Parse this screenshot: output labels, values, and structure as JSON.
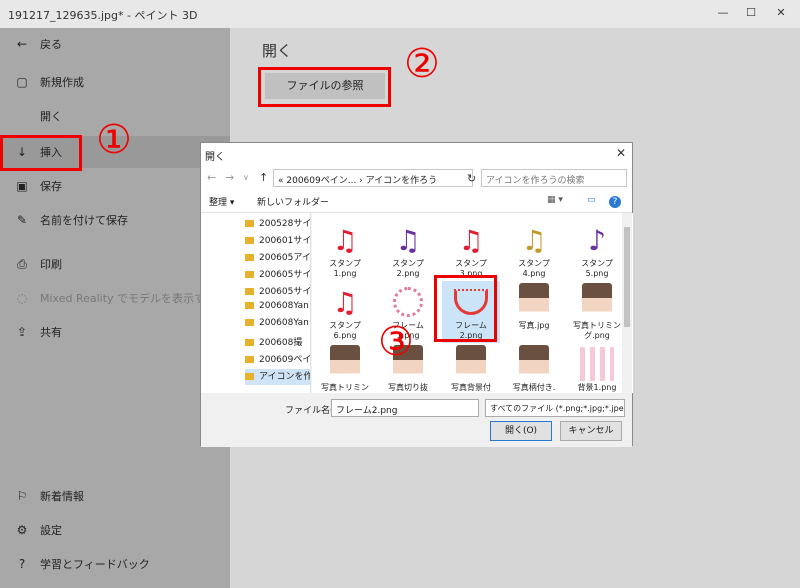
{
  "window": {
    "title": "191217_129635.jpg* - ペイント 3D",
    "controls": [
      "—",
      "☐",
      "✕"
    ]
  },
  "sidebar": {
    "items": [
      {
        "icon": "back-arrow-icon",
        "glyph": "←",
        "label": "戻る"
      },
      {
        "icon": "new-file-icon",
        "glyph": "▢",
        "label": "新規作成"
      },
      {
        "icon": "open-icon",
        "glyph": "",
        "label": "開く"
      },
      {
        "icon": "insert-icon",
        "glyph": "↓",
        "label": "挿入"
      },
      {
        "icon": "save-icon",
        "glyph": "▣",
        "label": "保存"
      },
      {
        "icon": "save-as-icon",
        "glyph": "✎",
        "label": "名前を付けて保存"
      },
      {
        "icon": "print-icon",
        "glyph": "⎙",
        "label": "印刷"
      },
      {
        "icon": "mixed-reality-icon",
        "glyph": "◌",
        "label": "Mixed Reality でモデルを表示する"
      },
      {
        "icon": "share-icon",
        "glyph": "⇪",
        "label": "共有"
      },
      {
        "icon": "news-icon",
        "glyph": "⚐",
        "label": "新着情報"
      },
      {
        "icon": "settings-icon",
        "glyph": "⚙",
        "label": "設定"
      },
      {
        "icon": "help-icon",
        "glyph": "?",
        "label": "学習とフィードバック"
      }
    ]
  },
  "main": {
    "title": "開く",
    "browse_label": "ファイルの参照"
  },
  "annotations": [
    "①",
    "②",
    "③"
  ],
  "dialog": {
    "title": "開く",
    "close": "✕",
    "nav": [
      "←",
      "→",
      "∨",
      "↑"
    ],
    "path": "« 200609ペイン... › アイコンを作ろう",
    "refresh": "↻",
    "search_placeholder": "アイコンを作ろうの検索",
    "toolbar": {
      "organize": "整理 ▾",
      "new_folder": "新しいフォルダー"
    },
    "folders": [
      "200528サイ",
      "200601サイ",
      "200605アイ",
      "200605サイ",
      "200605サイ",
      "200608Yan",
      "200608Yan",
      "200608撮",
      "200609ペイ",
      "アイコンを作"
    ],
    "files": [
      {
        "name": "スタンプ\n1.png",
        "kind": "note",
        "color": "#e01e2f",
        "glyph": "♫"
      },
      {
        "name": "スタンプ\n2.png",
        "kind": "note",
        "color": "#6b2fa0",
        "glyph": "♫"
      },
      {
        "name": "スタンプ\n3.png",
        "kind": "note",
        "color": "#e01e2f",
        "glyph": "♫"
      },
      {
        "name": "スタンプ\n4.png",
        "kind": "note",
        "color": "#c39a2a",
        "glyph": "♫"
      },
      {
        "name": "スタンプ\n5.png",
        "kind": "note",
        "color": "#6b2fa0",
        "glyph": "♪"
      },
      {
        "name": "スタンプ\n6.png",
        "kind": "note",
        "color": "#e01e2f",
        "glyph": "♫"
      },
      {
        "name": "フレーム\n1.png",
        "kind": "ring"
      },
      {
        "name": "フレーム\n2.png",
        "kind": "bowl"
      },
      {
        "name": "写真.jpg",
        "kind": "face"
      },
      {
        "name": "写真トリミン\nグ.png",
        "kind": "face"
      },
      {
        "name": "写真トリミン",
        "kind": "face"
      },
      {
        "name": "写真切り抜",
        "kind": "face"
      },
      {
        "name": "写真背景付",
        "kind": "face"
      },
      {
        "name": "写真柄付き.",
        "kind": "face"
      },
      {
        "name": "背景1.png",
        "kind": "pink"
      }
    ],
    "filename_label": "ファイル名(N):",
    "filename_value": "フレーム2.png",
    "filetype": "すべてのファイル (*.png;*.jpg;*.jpeg",
    "open_label": "開く(O)",
    "cancel_label": "キャンセル"
  }
}
